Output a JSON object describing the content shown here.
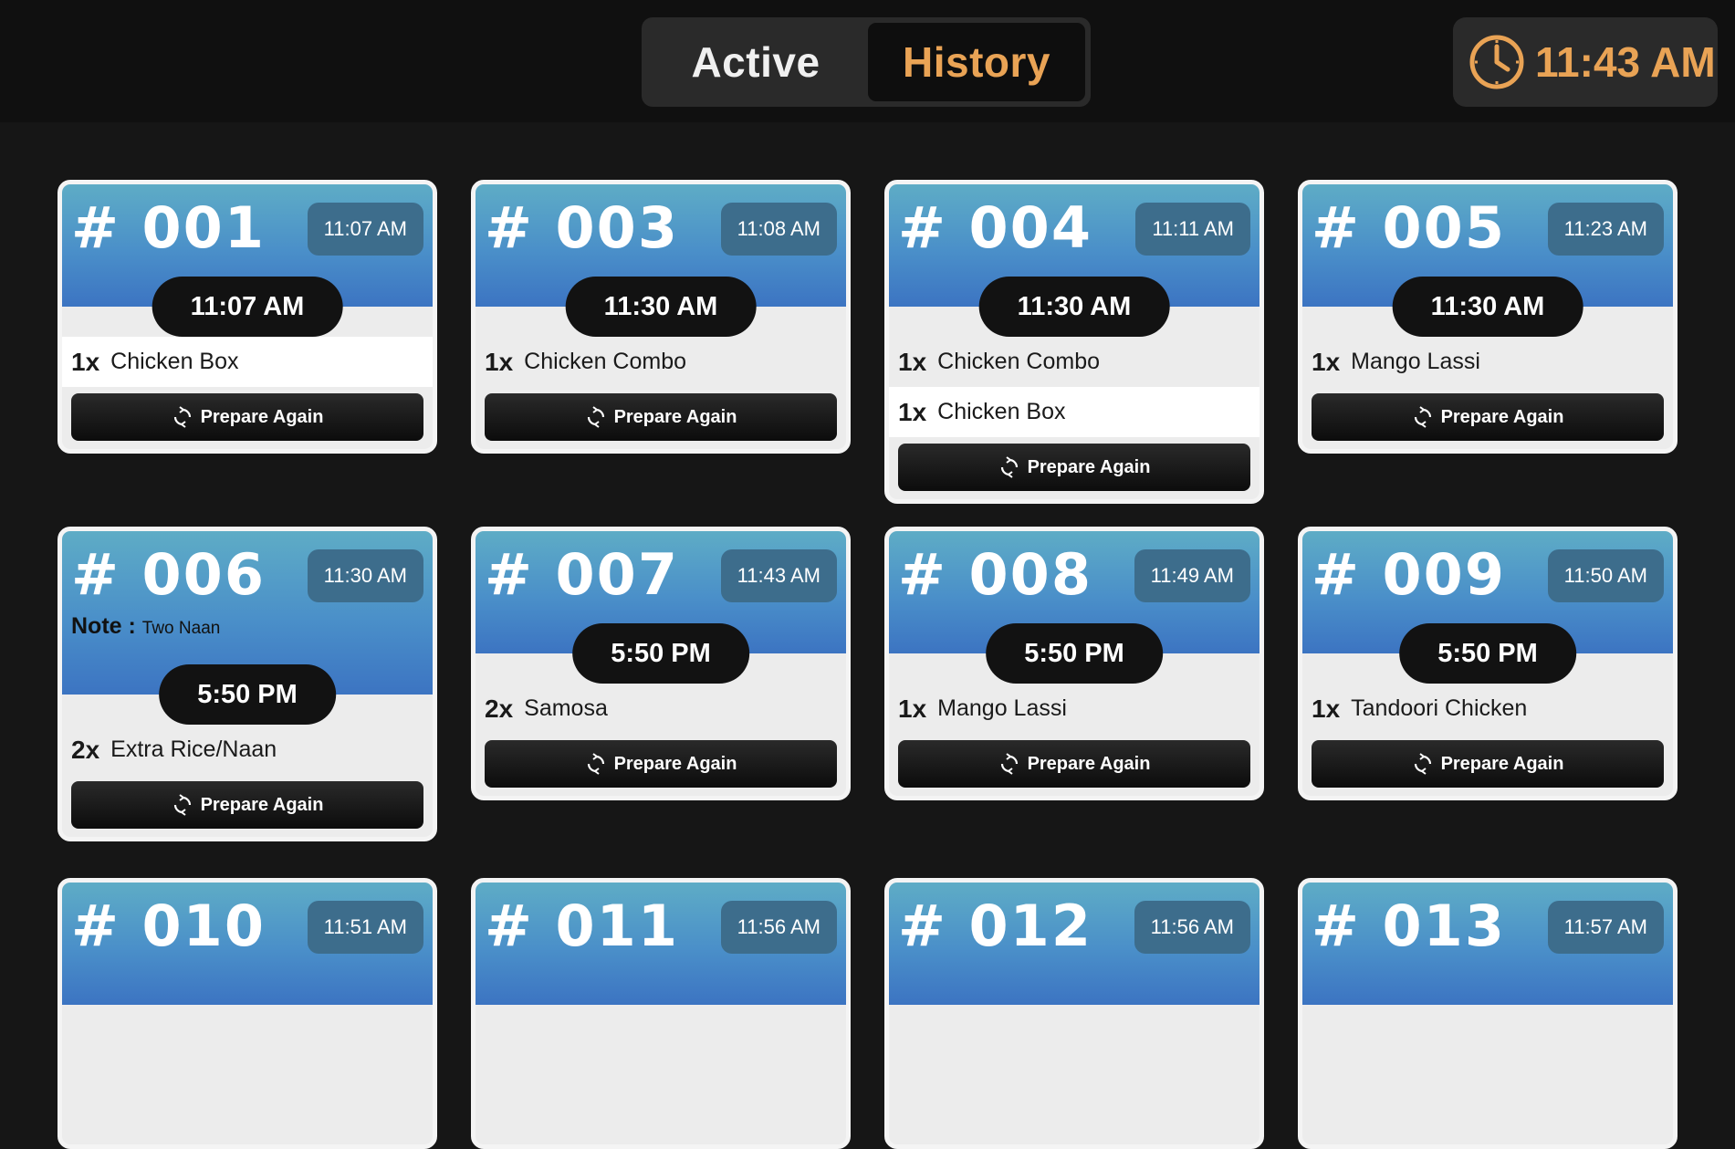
{
  "header": {
    "tabs": [
      {
        "label": "Active",
        "selected": false
      },
      {
        "label": "History",
        "selected": true
      }
    ],
    "clock_time": "11:43 AM",
    "accent_color": "#e9a355"
  },
  "orders": [
    {
      "number": "# 001",
      "placed": "11:07 AM",
      "ready": "11:07 AM",
      "note_label": "",
      "note": "",
      "items": [
        {
          "qty": "1x",
          "name": "Chicken Box"
        }
      ],
      "action": "Prepare Again"
    },
    {
      "number": "# 003",
      "placed": "11:08 AM",
      "ready": "11:30 AM",
      "note_label": "",
      "note": "",
      "items": [
        {
          "qty": "1x",
          "name": "Chicken Combo"
        }
      ],
      "action": "Prepare Again"
    },
    {
      "number": "# 004",
      "placed": "11:11 AM",
      "ready": "11:30 AM",
      "note_label": "",
      "note": "",
      "items": [
        {
          "qty": "1x",
          "name": "Chicken Combo"
        },
        {
          "qty": "1x",
          "name": "Chicken Box"
        }
      ],
      "action": "Prepare Again"
    },
    {
      "number": "# 005",
      "placed": "11:23 AM",
      "ready": "11:30 AM",
      "note_label": "",
      "note": "",
      "items": [
        {
          "qty": "1x",
          "name": "Mango Lassi"
        }
      ],
      "action": "Prepare Again"
    },
    {
      "number": "# 006",
      "placed": "11:30 AM",
      "ready": "5:50 PM",
      "note_label": "Note :",
      "note": "Two Naan",
      "items": [
        {
          "qty": "2x",
          "name": "Extra Rice/Naan"
        }
      ],
      "action": "Prepare Again"
    },
    {
      "number": "# 007",
      "placed": "11:43 AM",
      "ready": "5:50 PM",
      "note_label": "",
      "note": "",
      "items": [
        {
          "qty": "2x",
          "name": "Samosa"
        }
      ],
      "action": "Prepare Again"
    },
    {
      "number": "# 008",
      "placed": "11:49 AM",
      "ready": "5:50 PM",
      "note_label": "",
      "note": "",
      "items": [
        {
          "qty": "1x",
          "name": "Mango Lassi"
        }
      ],
      "action": "Prepare Again"
    },
    {
      "number": "# 009",
      "placed": "11:50 AM",
      "ready": "5:50 PM",
      "note_label": "",
      "note": "",
      "items": [
        {
          "qty": "1x",
          "name": "Tandoori Chicken"
        }
      ],
      "action": "Prepare Again"
    },
    {
      "number": "# 010",
      "placed": "11:51 AM",
      "ready": "",
      "note_label": "",
      "note": "",
      "items": [],
      "action": ""
    },
    {
      "number": "# 011",
      "placed": "11:56 AM",
      "ready": "",
      "note_label": "",
      "note": "",
      "items": [],
      "action": ""
    },
    {
      "number": "# 012",
      "placed": "11:56 AM",
      "ready": "",
      "note_label": "",
      "note": "",
      "items": [],
      "action": ""
    },
    {
      "number": "# 013",
      "placed": "11:57 AM",
      "ready": "",
      "note_label": "",
      "note": "",
      "items": [],
      "action": ""
    }
  ]
}
